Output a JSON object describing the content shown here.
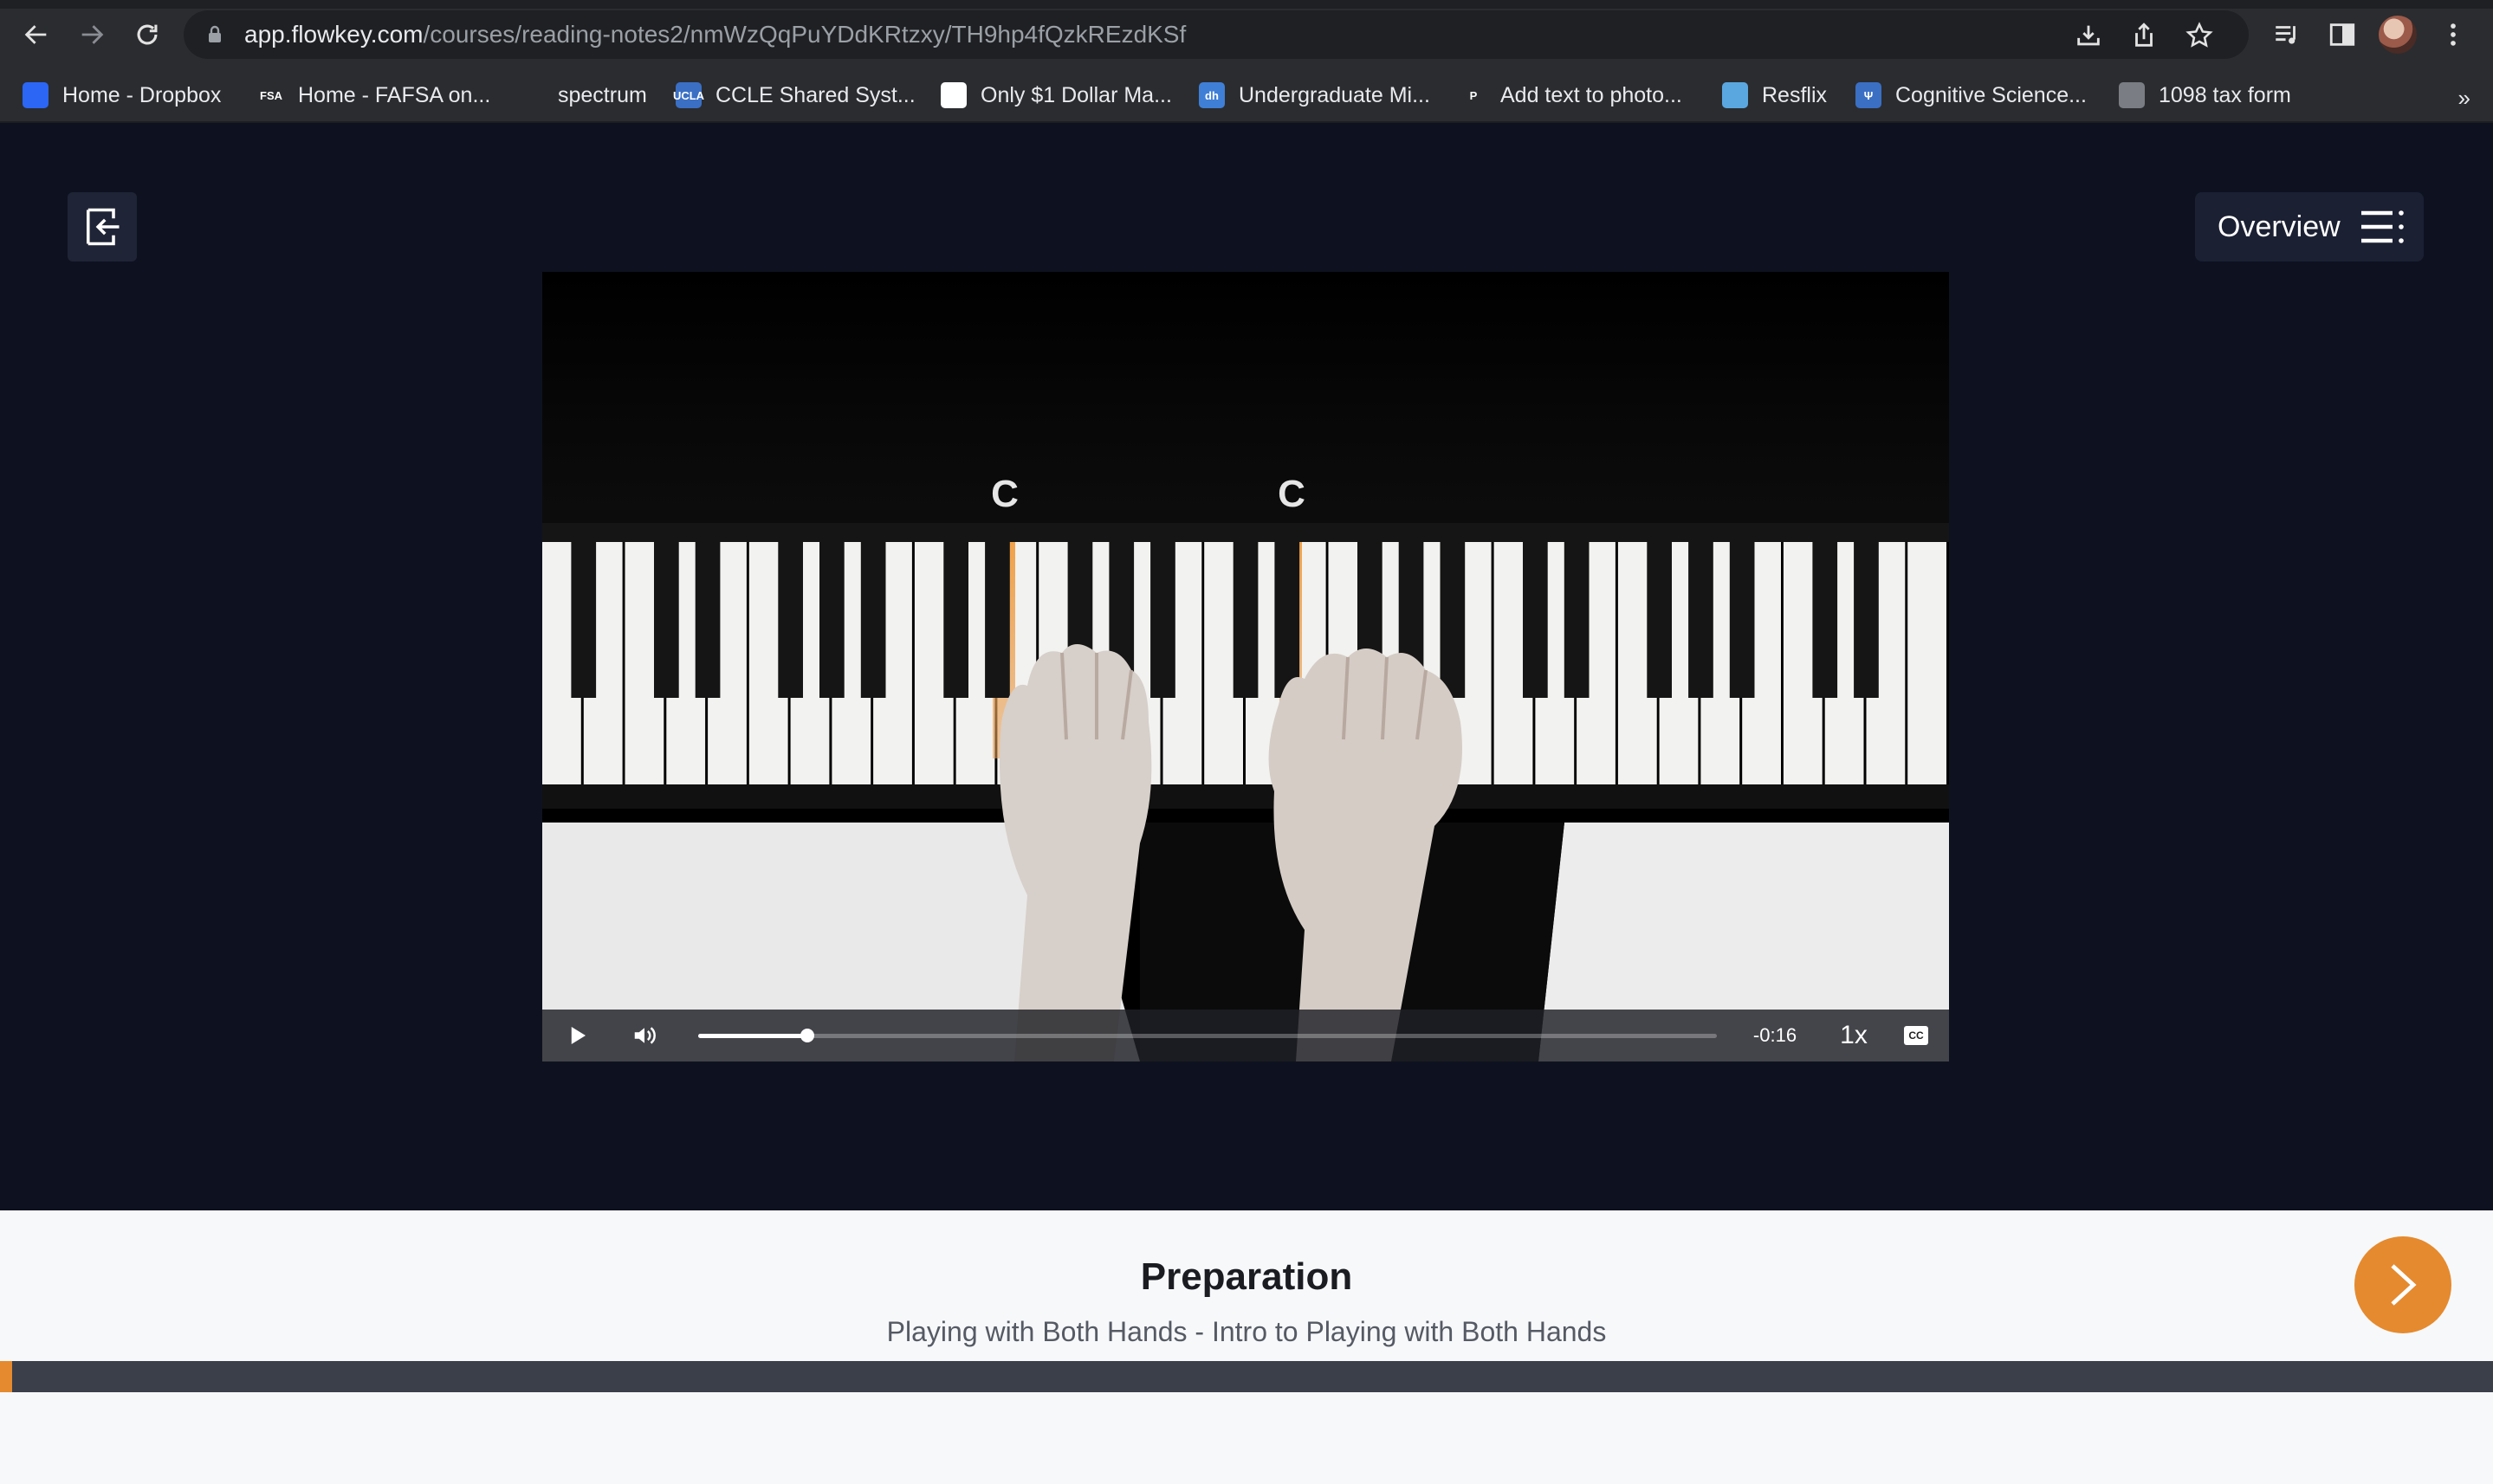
{
  "browser": {
    "url_host": "app.flowkey.com",
    "url_path": "/courses/reading-notes2/nmWzQqPuYDdKRtzxy/TH9hp4fQzkREzdKSf",
    "bookmarks": [
      {
        "label": "Home - Dropbox",
        "icon": "dropbox-icon",
        "fav_text": "",
        "color": "#2b66f5"
      },
      {
        "label": "Home - FAFSA on...",
        "icon": "fsa-icon",
        "fav_text": "FSA",
        "color": "#2b2c2f"
      },
      {
        "label": "spectrum",
        "icon": "spectrum-icon",
        "fav_text": "",
        "color": "#2b2c2f"
      },
      {
        "label": "CCLE Shared Syst...",
        "icon": "ucla-icon",
        "fav_text": "UCLA",
        "color": "#3a6fc4"
      },
      {
        "label": "Only $1 Dollar Ma...",
        "icon": "only1-icon",
        "fav_text": "",
        "color": "#ffffff"
      },
      {
        "label": "Undergraduate Mi...",
        "icon": "dh-icon",
        "fav_text": "dh",
        "color": "#3f7fd6"
      },
      {
        "label": "Add text to photo...",
        "icon": "picmonkey-icon",
        "fav_text": "P",
        "color": "#2b2c2f"
      },
      {
        "label": "Resflix",
        "icon": "resflix-icon",
        "fav_text": "",
        "color": "#5aa7e0"
      },
      {
        "label": "Cognitive Science...",
        "icon": "psi-icon",
        "fav_text": "Ψ",
        "color": "#3a6fc4"
      },
      {
        "label": "1098 tax form",
        "icon": "globe-icon",
        "fav_text": "",
        "color": "#7a7d83"
      }
    ],
    "more_label": "»"
  },
  "app": {
    "overview_label": "Overview",
    "exit_icon": "exit-icon",
    "overview_icon": "list-icon"
  },
  "video": {
    "note_labels": [
      "C",
      "C"
    ],
    "time_remaining": "-0:16",
    "speed": "1x",
    "cc_label": "CC",
    "progress": 0.107,
    "highlight_color": "#e58a2e"
  },
  "lesson": {
    "title": "Preparation",
    "subtitle": "Playing with Both Hands - Intro to Playing with Both Hands",
    "accent": "#e58a2e",
    "course_progress": 0.005
  }
}
